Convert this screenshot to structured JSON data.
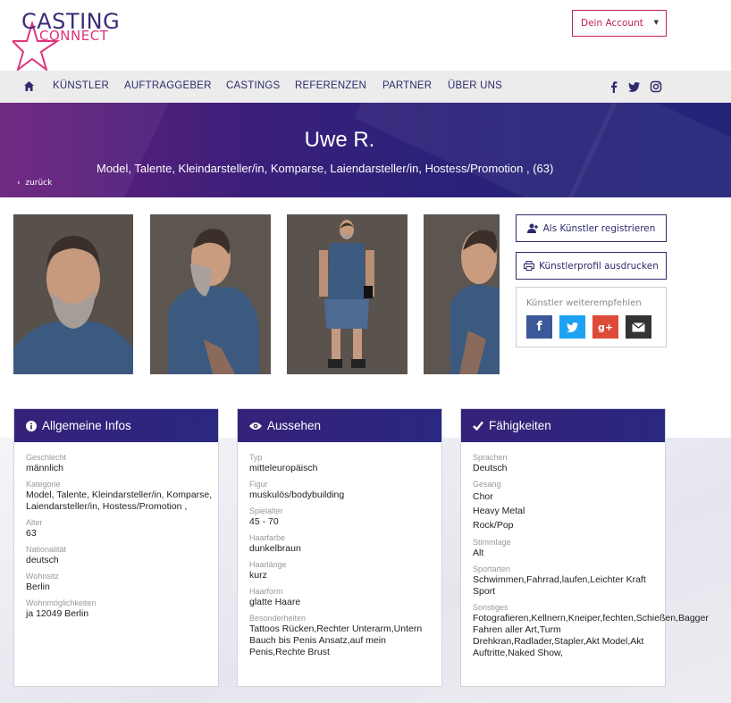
{
  "header": {
    "logo_line1": "CASTING",
    "logo_line2": "CONNECT",
    "account_label": "Dein Account",
    "account_caret": "▼"
  },
  "nav": {
    "items": [
      "KÜNSTLER",
      "AUFTRAGGEBER",
      "CASTINGS",
      "REFERENZEN",
      "PARTNER",
      "ÜBER UNS"
    ],
    "social": [
      "facebook-icon",
      "twitter-icon",
      "instagram-icon"
    ]
  },
  "hero": {
    "name": "Uwe R.",
    "subtitle": "Model, Talente, Kleindarsteller/in, Komparse, Laiendarsteller/in, Hostess/Promotion , (63)",
    "back_label": "zurück"
  },
  "actions": {
    "register_label": "Als Künstler registrieren",
    "print_label": "Künstlerprofil ausdrucken",
    "recommend_label": "Künstler weiterempfehlen",
    "share": [
      {
        "icon": "facebook-icon",
        "color": "#3b5998",
        "glyph": "f"
      },
      {
        "icon": "twitter-icon",
        "color": "#1da1f2",
        "glyph": "t"
      },
      {
        "icon": "google-plus-icon",
        "color": "#dd4b39",
        "glyph": "g+"
      },
      {
        "icon": "mail-icon",
        "color": "#333333",
        "glyph": "✉"
      }
    ]
  },
  "cards": {
    "general": {
      "title": "Allgemeine Infos",
      "fields": [
        {
          "label": "Geschlecht",
          "value": "männlich"
        },
        {
          "label": "Kategorie",
          "value": "Model, Talente, Kleindarsteller/in, Komparse, Laiendarsteller/in, Hostess/Promotion ,"
        },
        {
          "label": "Alter",
          "value": "63"
        },
        {
          "label": "Nationalität",
          "value": "deutsch"
        },
        {
          "label": "Wohnsitz",
          "value": "Berlin"
        },
        {
          "label": "Wohnmöglichkeiten",
          "value": "ja 12049 Berlin"
        }
      ]
    },
    "looks": {
      "title": "Aussehen",
      "fields": [
        {
          "label": "Typ",
          "value": "mitteleuropäisch"
        },
        {
          "label": "Figur",
          "value": "muskulös/bodybuilding"
        },
        {
          "label": "Spielalter",
          "value": "45 - 70"
        },
        {
          "label": "Haarfarbe",
          "value": "dunkelbraun"
        },
        {
          "label": "Haarlänge",
          "value": "kurz"
        },
        {
          "label": "Haarform",
          "value": "glatte Haare"
        },
        {
          "label": "Besonderheiten",
          "value": "Tattoos Rücken,Rechter Unterarm,Untern Bauch bis Penis Ansatz,auf mein Penis,Rechte Brust"
        }
      ]
    },
    "skills": {
      "title": "Fähigkeiten",
      "languages_label": "Sprachen",
      "languages": "Deutsch",
      "singing_label": "Gesang",
      "singing": [
        "Chor",
        "Heavy Metal",
        "Rock/Pop"
      ],
      "voice_label": "Stimmlage",
      "voice": "Alt",
      "sports_label": "Sportarten",
      "sports": "Schwimmen,Fahrrad,laufen,Leichter Kraft Sport",
      "other_label": "Sonstiges",
      "other": "Fotografieren,Kellnern,Kneiper,fechten,Schießen,Bagger Fahren aller Art,Turm Drehkran,Radlader,Stapler,Akt Model,Akt Auftritte,Naked Show,"
    }
  },
  "colors": {
    "brand_dark": "#2d2a6e",
    "brand_pink": "#c0205f"
  }
}
